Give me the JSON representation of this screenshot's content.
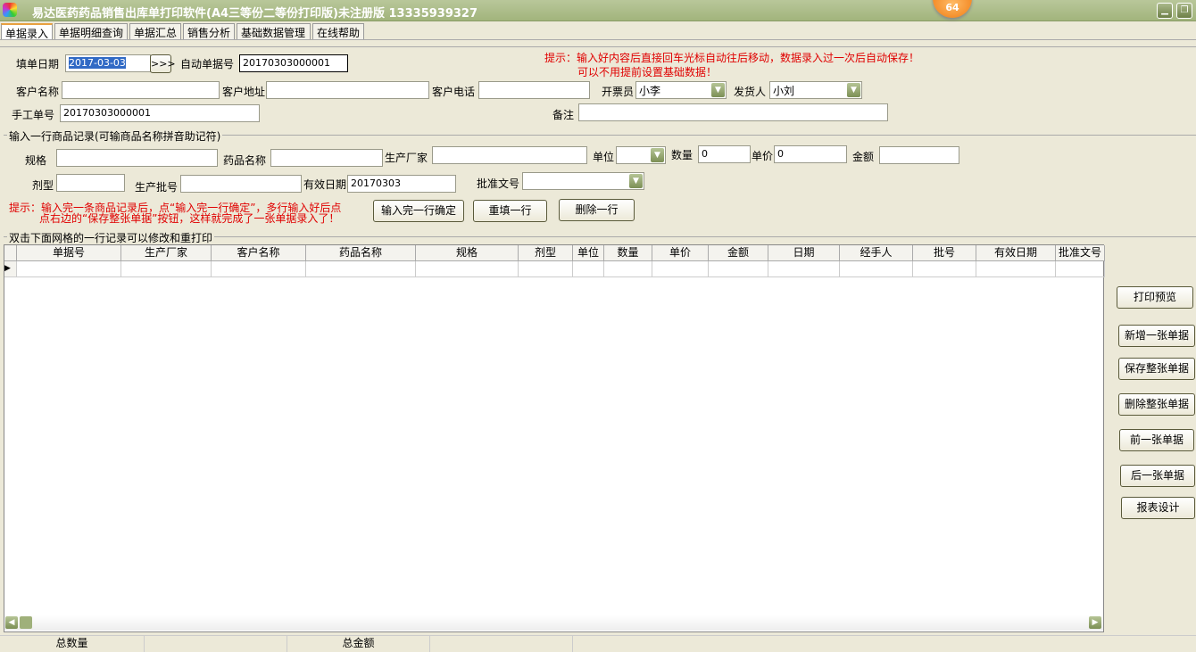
{
  "window": {
    "title": "易达医药药品销售出库单打印软件(A4三等份二等份打印版)未注册版  13335939327",
    "badge": "64"
  },
  "tabs": [
    "单据录入",
    "单据明细查询",
    "单据汇总",
    "销售分析",
    "基础数据管理",
    "在线帮助"
  ],
  "header": {
    "fill_date_label": "填单日期",
    "fill_date": "2017-03-03",
    "date_btn": ">>>",
    "auto_no_label": "自动单据号",
    "auto_no": "20170303000001",
    "customer_name_label": "客户名称",
    "customer_address_label": "客户地址",
    "customer_phone_label": "客户电话",
    "invoicer_label": "开票员",
    "invoicer": "小李",
    "shipper_label": "发货人",
    "shipper": "小刘",
    "manual_no_label": "手工单号",
    "manual_no": "20170303000001",
    "remark_label": "备注",
    "tip1": "提示：输入好内容后直接回车光标自动往后移动，数据录入过一次后自动保存！",
    "tip2": "可以不用提前设置基础数据！"
  },
  "item": {
    "group_title": "输入一行商品记录(可输商品名称拼音助记符)",
    "spec_label": "规格",
    "drug_label": "药品名称",
    "maker_label": "生产厂家",
    "unit_label": "单位",
    "qty_label": "数量",
    "qty": "0",
    "price_label": "单价",
    "price": "0",
    "amount_label": "金额",
    "form_label": "剂型",
    "batch_label": "生产批号",
    "expiry_label": "有效日期",
    "expiry": "20170303",
    "approval_label": "批准文号",
    "tip1": "提示：输入完一条商品记录后，点“输入完一行确定”，多行输入好后点",
    "tip2": "点右边的“保存整张单据”按钮，这样就完成了一张单据录入了！",
    "confirm_btn": "输入完一行确定",
    "refill_btn": "重填一行",
    "delete_btn": "删除一行"
  },
  "grid": {
    "title": "双击下面网格的一行记录可以修改和重打印",
    "columns": [
      "单据号",
      "生产厂家",
      "客户名称",
      "药品名称",
      "规格",
      "剂型",
      "单位",
      "数量",
      "单价",
      "金额",
      "日期",
      "经手人",
      "批号",
      "有效日期",
      "批准文号"
    ]
  },
  "side_buttons": [
    "打印预览",
    "新增一张单据",
    "保存整张单据",
    "删除整张单据",
    "前一张单据",
    "后一张单据",
    "报表设计"
  ],
  "status": {
    "total_qty": "总数量",
    "total_amount": "总金额"
  }
}
